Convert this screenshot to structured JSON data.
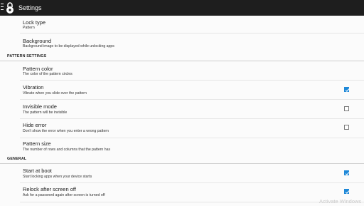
{
  "app": {
    "title": "Settings",
    "icons": {
      "menu": "menu-icon",
      "lock": "lock-icon"
    }
  },
  "general_prefs": [
    {
      "title": "Lock type",
      "subtitle": "Pattern"
    },
    {
      "title": "Background",
      "subtitle": "Background image to be displayed while unlocking apps"
    }
  ],
  "pattern_section": {
    "header": "PATTERN SETTINGS",
    "items": [
      {
        "title": "Pattern color",
        "subtitle": "The color of the pattern circles"
      },
      {
        "title": "Vibration",
        "subtitle": "Vibrate when you slide over the pattern",
        "checked": true
      },
      {
        "title": "Invisible mode",
        "subtitle": "The pattern will be invisible",
        "checked": false
      },
      {
        "title": "Hide error",
        "subtitle": "Don't show the error when you enter a wrong pattern",
        "checked": false
      },
      {
        "title": "Pattern size",
        "subtitle": "The number of rows and columns that the pattern has"
      }
    ]
  },
  "general_section": {
    "header": "GENERAL",
    "items": [
      {
        "title": "Start at boot",
        "subtitle": "Start locking apps when your device starts",
        "checked": true
      },
      {
        "title": "Relock after screen off",
        "subtitle": "Ask for a password again after screen is turned off",
        "checked": true
      }
    ]
  },
  "watermark": "Activate Windows",
  "colors": {
    "titlebar": "#1e1e1e",
    "checkbox_checked": "#1e88d8",
    "background": "#fbfbfb"
  }
}
